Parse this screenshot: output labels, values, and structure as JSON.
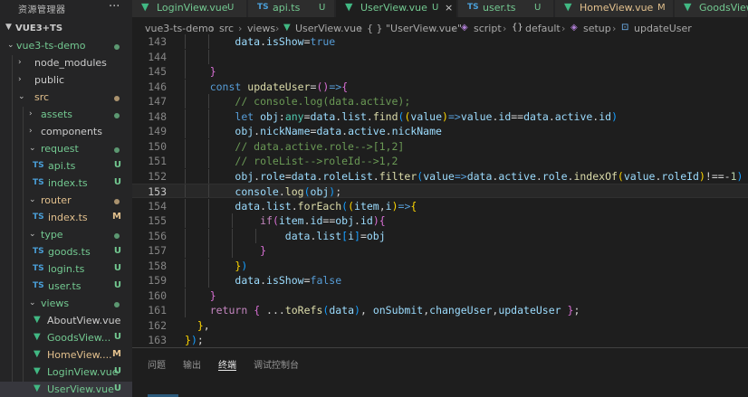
{
  "sidebar": {
    "title": "资源管理器",
    "more": "···",
    "root_label": "VUE3+TS",
    "items": [
      {
        "label": "vue3-ts-demo",
        "status": "dot"
      },
      {
        "label": "node_modules",
        "status": ""
      },
      {
        "label": "public",
        "status": ""
      },
      {
        "label": "src",
        "status": "dot-m"
      },
      {
        "label": "assets",
        "status": "dot"
      },
      {
        "label": "components",
        "status": ""
      },
      {
        "label": "request",
        "status": "dot"
      },
      {
        "label": "api.ts",
        "status": "U"
      },
      {
        "label": "index.ts",
        "status": "U"
      },
      {
        "label": "router",
        "status": "dot-m"
      },
      {
        "label": "index.ts",
        "status": "M"
      },
      {
        "label": "type",
        "status": "dot"
      },
      {
        "label": "goods.ts",
        "status": "U"
      },
      {
        "label": "login.ts",
        "status": "U"
      },
      {
        "label": "user.ts",
        "status": "U"
      },
      {
        "label": "views",
        "status": "dot"
      },
      {
        "label": "AboutView.vue",
        "status": ""
      },
      {
        "label": "GoodsView...",
        "status": "U"
      },
      {
        "label": "HomeView....",
        "status": "M"
      },
      {
        "label": "LoginView.vue",
        "status": "U"
      },
      {
        "label": "UserView.vue",
        "status": "U"
      }
    ]
  },
  "tabs": [
    {
      "label": "LoginView.vue",
      "status": "U",
      "icon": "vue"
    },
    {
      "label": "api.ts",
      "status": "U",
      "icon": "TS"
    },
    {
      "label": "UserView.vue",
      "status": "U",
      "icon": "vue"
    },
    {
      "label": "user.ts",
      "status": "U",
      "icon": "TS"
    },
    {
      "label": "HomeView.vue",
      "status": "M",
      "icon": "vue"
    },
    {
      "label": "GoodsView",
      "status": "",
      "icon": "vue"
    }
  ],
  "breadcrumb": {
    "items": [
      "vue3-ts-demo",
      "src",
      "views",
      "UserView.vue",
      "{ } \"UserView.vue\"",
      "script",
      "default",
      "setup",
      "updateUser"
    ]
  },
  "editor": {
    "line_numbers": [
      "143",
      "144",
      "145",
      "146",
      "147",
      "148",
      "149",
      "150",
      "151",
      "152",
      "153",
      "154",
      "155",
      "156",
      "157",
      "158",
      "159",
      "160",
      "161",
      "162",
      "163"
    ],
    "current_line": "153"
  },
  "panel": {
    "tabs": [
      "问题",
      "输出",
      "终端",
      "调试控制台"
    ],
    "active_tab": "终端"
  },
  "colors": {
    "git_untracked": "#73c991",
    "git_modified": "#e2c08d",
    "keyword": "#569cd6",
    "function": "#dcdcaa",
    "variable": "#9cdcfe",
    "comment": "#6a9955"
  }
}
